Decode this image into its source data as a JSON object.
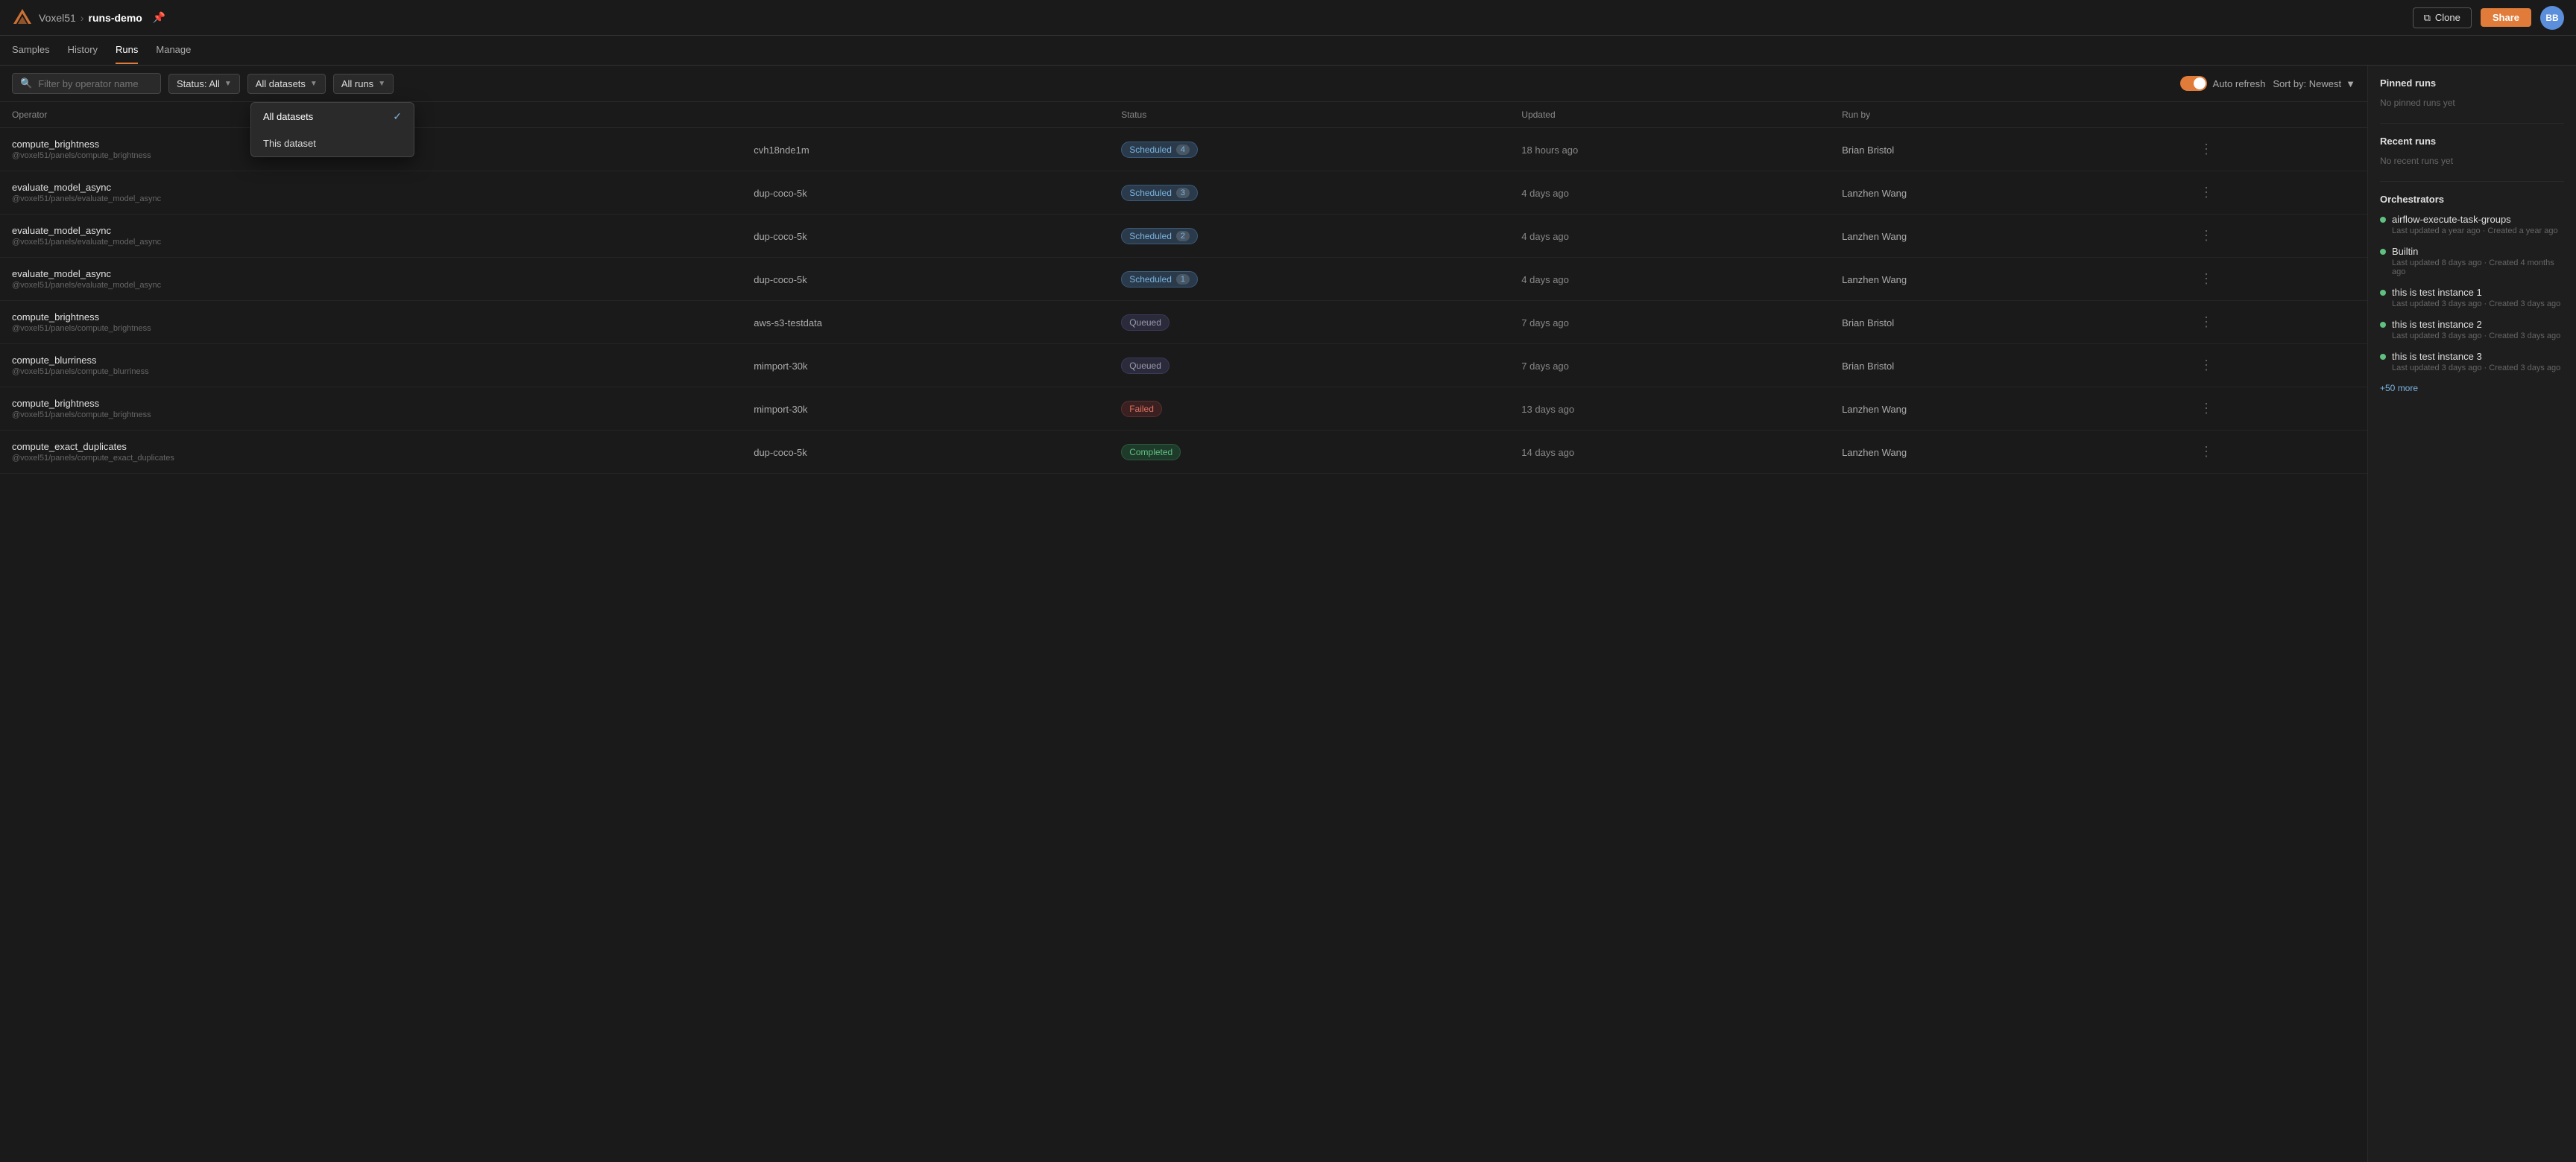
{
  "app": {
    "logo_text": "V51",
    "org_name": "Voxel51",
    "separator": "›",
    "project_name": "runs-demo",
    "pin_icon": "📌"
  },
  "topbar": {
    "clone_label": "Clone",
    "share_label": "Share",
    "avatar_initials": "BB"
  },
  "tabnav": {
    "items": [
      {
        "label": "Samples",
        "active": false
      },
      {
        "label": "History",
        "active": false
      },
      {
        "label": "Runs",
        "active": true
      },
      {
        "label": "Manage",
        "active": false
      }
    ]
  },
  "filters": {
    "search_placeholder": "Filter by operator name",
    "status_label": "Status: All",
    "dataset_label": "All datasets",
    "runs_label": "All runs",
    "auto_refresh_label": "Auto refresh",
    "sort_label": "Sort by: Newest"
  },
  "dropdown": {
    "items": [
      {
        "label": "All datasets",
        "selected": true
      },
      {
        "label": "This dataset",
        "selected": false
      }
    ]
  },
  "table": {
    "columns": [
      "Operator",
      "",
      "Status",
      "Updated",
      "Run by",
      ""
    ],
    "rows": [
      {
        "operator": "compute_brightness",
        "path": "@voxel51/panels/compute_brightness",
        "dataset": "cvh18nde1m",
        "status": "Scheduled",
        "status_type": "scheduled",
        "status_count": "4",
        "updated": "18 hours ago",
        "run_by": "Brian Bristol"
      },
      {
        "operator": "evaluate_model_async",
        "path": "@voxel51/panels/evaluate_model_async",
        "dataset": "dup-coco-5k",
        "status": "Scheduled",
        "status_type": "scheduled",
        "status_count": "3",
        "updated": "4 days ago",
        "run_by": "Lanzhen Wang"
      },
      {
        "operator": "evaluate_model_async",
        "path": "@voxel51/panels/evaluate_model_async",
        "dataset": "dup-coco-5k",
        "status": "Scheduled",
        "status_type": "scheduled",
        "status_count": "2",
        "updated": "4 days ago",
        "run_by": "Lanzhen Wang"
      },
      {
        "operator": "evaluate_model_async",
        "path": "@voxel51/panels/evaluate_model_async",
        "dataset": "dup-coco-5k",
        "status": "Scheduled",
        "status_type": "scheduled",
        "status_count": "1",
        "updated": "4 days ago",
        "run_by": "Lanzhen Wang"
      },
      {
        "operator": "compute_brightness",
        "path": "@voxel51/panels/compute_brightness",
        "dataset": "aws-s3-testdata",
        "status": "Queued",
        "status_type": "queued",
        "status_count": "",
        "updated": "7 days ago",
        "run_by": "Brian Bristol"
      },
      {
        "operator": "compute_blurriness",
        "path": "@voxel51/panels/compute_blurriness",
        "dataset": "mimport-30k",
        "status": "Queued",
        "status_type": "queued",
        "status_count": "",
        "updated": "7 days ago",
        "run_by": "Brian Bristol"
      },
      {
        "operator": "compute_brightness",
        "path": "@voxel51/panels/compute_brightness",
        "dataset": "mimport-30k",
        "status": "Failed",
        "status_type": "failed",
        "status_count": "",
        "updated": "13 days ago",
        "run_by": "Lanzhen Wang"
      },
      {
        "operator": "compute_exact_duplicates",
        "path": "@voxel51/panels/compute_exact_duplicates",
        "dataset": "dup-coco-5k",
        "status": "Completed",
        "status_type": "completed",
        "status_count": "",
        "updated": "14 days ago",
        "run_by": "Lanzhen Wang"
      }
    ]
  },
  "sidebar": {
    "pinned_title": "Pinned runs",
    "pinned_empty": "No pinned runs yet",
    "recent_title": "Recent runs",
    "recent_empty": "No recent runs yet",
    "orchestrators_title": "Orchestrators",
    "orchestrators": [
      {
        "name": "airflow-execute-task-groups",
        "meta": "Last updated a year ago · Created a year ago"
      },
      {
        "name": "Builtin",
        "meta": "Last updated 8 days ago · Created 4 months ago"
      },
      {
        "name": "this is test instance 1",
        "meta": "Last updated 3 days ago · Created 3 days ago"
      },
      {
        "name": "this is test instance 2",
        "meta": "Last updated 3 days ago · Created 3 days ago"
      },
      {
        "name": "this is test instance 3",
        "meta": "Last updated 3 days ago · Created 3 days ago"
      }
    ],
    "more_label": "+50 more"
  }
}
